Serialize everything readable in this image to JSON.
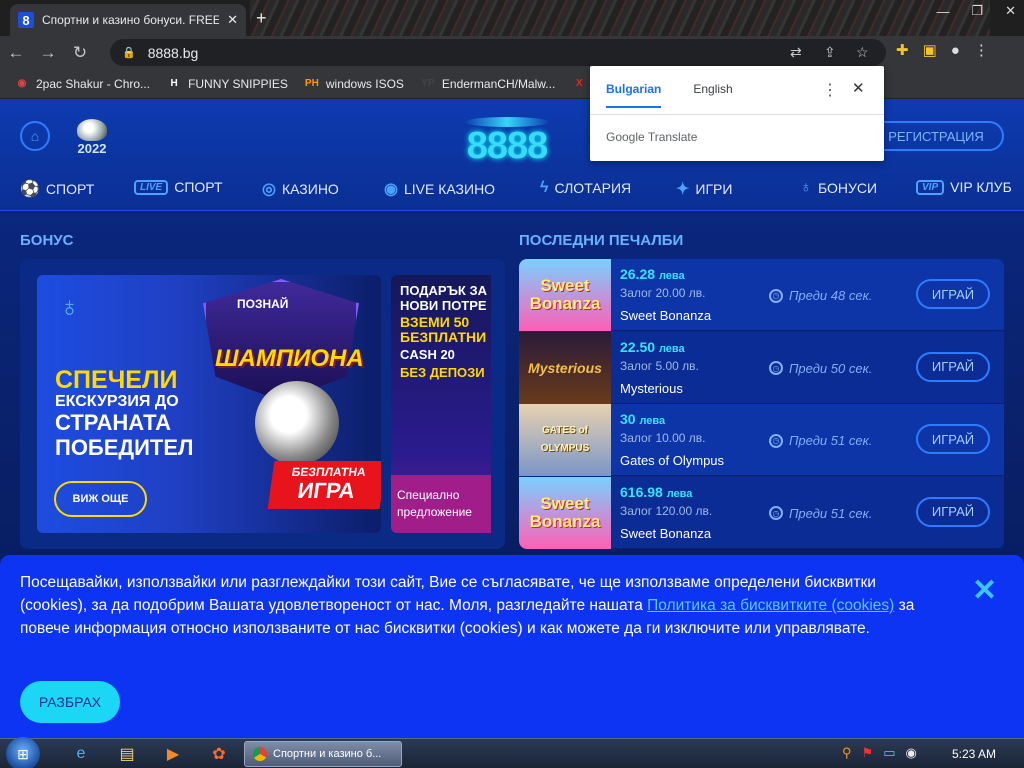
{
  "browser": {
    "tab_title": "Спортни и казино бонуси. FREE",
    "tab_favicon": "8",
    "tab_close": "✕",
    "new_tab": "+",
    "url": "8888.bg",
    "bookmarks": [
      {
        "icon": "firefox-icon",
        "label": "2pac Shakur - Chro...",
        "badge": "◉",
        "color": "#d44"
      },
      {
        "icon": "h-icon",
        "label": "FUNNY SNIPPIES",
        "badge": "H",
        "color": "#fff"
      },
      {
        "icon": "ph-icon",
        "label": "windows ISOS",
        "badge": "PH",
        "color": "#f90"
      },
      {
        "icon": "yp-icon",
        "label": "EndermanCH/Malw...",
        "badge": "YP",
        "color": "#444"
      },
      {
        "icon": "x-icon",
        "label": "",
        "badge": "X",
        "color": "#e22"
      }
    ]
  },
  "translate_popup": {
    "lang_active": "Bulgarian",
    "lang_other": "English",
    "footer": "Google Translate"
  },
  "site": {
    "year": "2022",
    "logo": "8888",
    "register": "РЕГИСТРАЦИЯ",
    "nav": [
      {
        "label": "СПОРТ",
        "icon": "football-icon"
      },
      {
        "label": "СПОРТ",
        "icon": "live-icon",
        "badge": "LIVE"
      },
      {
        "label": "КАЗИНО",
        "icon": "chip-icon"
      },
      {
        "label": "LIVE КАЗИНО",
        "icon": "live-casino-icon"
      },
      {
        "label": "СЛОТАРИЯ",
        "icon": "bolt-icon"
      },
      {
        "label": "ИГРИ",
        "icon": "games-icon"
      },
      {
        "label": "БОНУСИ",
        "icon": "balloon-icon"
      },
      {
        "label": "VIP КЛУБ",
        "icon": "vip-icon",
        "badge": "VIP"
      }
    ],
    "bonus_title": "БОНУС",
    "wins_title": "ПОСЛЕДНИ ПЕЧАЛБИ",
    "banner": {
      "headline1": "СПЕЧЕЛИ",
      "headline2": "ЕКСКУРЗИЯ ДО",
      "headline3": "СТРАНАТА",
      "headline4": "ПОБЕДИТЕЛ",
      "crest_top": "ПОЗНАЙ",
      "crest_main": "ШАМПИОНА",
      "tag_small": "БЕЗПЛАТНА",
      "tag_big": "ИГРА",
      "cta": "ВИЖ ОЩЕ"
    },
    "banner2": {
      "line1": "ПОДАРЪК ЗА",
      "line2": "НОВИ ПОТРЕ",
      "line3": "ВЗЕМИ 50",
      "line4": "БЕЗПЛАТНИ",
      "line5": "CASH 20",
      "line6": "БЕЗ ДЕПОЗИ",
      "footer": "Специално предложение"
    },
    "wins": [
      {
        "amount": "26.28",
        "unit": "лева",
        "stake": "Залог 20.00 лв.",
        "game": "Sweet Bonanza",
        "thumb": "Sweet Bonanza",
        "when": "Преди 48 сек.",
        "play": "ИГРАЙ"
      },
      {
        "amount": "22.50",
        "unit": "лева",
        "stake": "Залог 5.00 лв.",
        "game": "Mysterious",
        "thumb": "Mysterious",
        "when": "Преди 50 сек.",
        "play": "ИГРАЙ"
      },
      {
        "amount": "30",
        "unit": "лева",
        "stake": "Залог 10.00 лв.",
        "game": "Gates of Olympus",
        "thumb": "GATES of OLYMPUS",
        "when": "Преди 51 сек.",
        "play": "ИГРАЙ"
      },
      {
        "amount": "616.98",
        "unit": "лева",
        "stake": "Залог 120.00 лв.",
        "game": "Sweet Bonanza",
        "thumb": "Sweet Bonanza",
        "when": "Преди 51 сек.",
        "play": "ИГРАЙ"
      }
    ]
  },
  "cookie": {
    "text_before": "Посещавайки, използвайки или разглеждайки този сайт, Вие се съгласявате, че ще използваме определени бисквитки (cookies), за да подобрим Вашата удовлетвореност от нас. Моля, разгледайте нашата ",
    "link": "Политика за бисквитките (cookies)",
    "text_after": " за повече информация относно използваните от нас бисквитки (cookies) и как можете да ги изключите или управлявате.",
    "accept": "РАЗБРАХ"
  },
  "taskbar": {
    "task_label": "Спортни и казино б...",
    "clock": "5:23 AM"
  },
  "colors": {
    "accent": "#3ad9ff",
    "cookie_bg": "#0d34f2",
    "section_title": "#67b3ff"
  }
}
